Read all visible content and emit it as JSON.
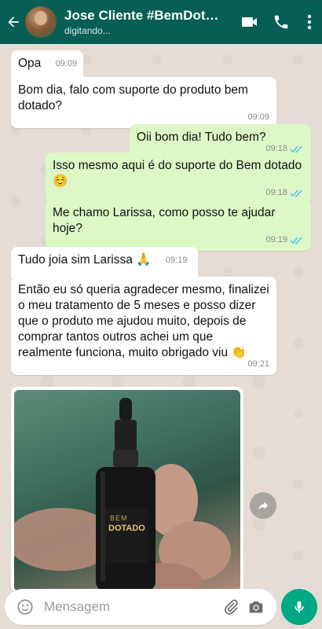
{
  "header": {
    "contact_name": "Jose Cliente #BemDotado",
    "status": "digitando..."
  },
  "messages": [
    {
      "dir": "in",
      "text": "Opa",
      "time": "09:09"
    },
    {
      "dir": "in",
      "text": "Bom dia, falo com suporte do produto bem dotado?",
      "time": "09:09"
    },
    {
      "dir": "out",
      "text": "Oii bom dia! Tudo bem?",
      "time": "09:18",
      "read": true
    },
    {
      "dir": "out",
      "text": "Isso mesmo aqui é do suporte do Bem dotado ☺️",
      "time": "09:18",
      "read": true
    },
    {
      "dir": "out",
      "text": "Me chamo Larissa, como posso te ajudar hoje?",
      "time": "09:19",
      "read": true
    },
    {
      "dir": "in",
      "text": "Tudo joia sim Larissa 🙏",
      "time": "09:19"
    },
    {
      "dir": "in",
      "text": "Então eu só queria agradecer mesmo, finalizei o meu tratamento de 5 meses e posso dizer que o produto me ajudou muito, depois de comprar tantos outros achei um que realmente funciona, muito obrigado viu 👏",
      "time": "09:21"
    }
  ],
  "photo": {
    "bottle_label_line1": "BEM",
    "bottle_label_line2": "DOTADO"
  },
  "input": {
    "placeholder": "Mensagem"
  },
  "colors": {
    "header": "#075e54",
    "outgoing_bubble": "#dcf8c6",
    "incoming_bubble": "#ffffff",
    "chat_background": "#e5ddd5",
    "mic_button": "#00a884",
    "read_ticks": "#4fc3f7"
  },
  "icons": [
    "back-arrow-icon",
    "video-call-icon",
    "phone-icon",
    "more-options-icon",
    "share-icon",
    "emoji-icon",
    "attach-icon",
    "camera-icon",
    "mic-icon",
    "double-check-icon"
  ]
}
